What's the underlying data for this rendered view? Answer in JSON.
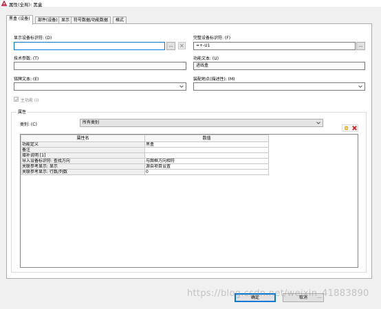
{
  "window": {
    "title": "属性(全局): 黑盒"
  },
  "tabs": [
    {
      "label": "黑盒 (设备)",
      "active": true
    },
    {
      "label": "部件(设备)",
      "active": false
    },
    {
      "label": "显示",
      "active": false
    },
    {
      "label": "符号数据/功能数据",
      "active": false
    },
    {
      "label": "格式",
      "active": false
    }
  ],
  "fields": {
    "display_dt_label": "显示设备标识符: (D)",
    "display_dt_value": "",
    "full_dt_label": "完整设备标识符: (F)",
    "full_dt_value": "=+-U1",
    "tech_params_label": "技术参数: (T)",
    "tech_params_value": "",
    "function_text_label": "功能文本: (U)",
    "function_text_value": "进线盒",
    "engraving_label": "铭牌文本: (E)",
    "engraving_value": "",
    "mounting_label": "装配地点(描述性): (M)",
    "mounting_value": "",
    "main_function_label": "主功能 (I)",
    "main_function_checked": true,
    "ellipsis": "..."
  },
  "properties": {
    "group_title": "属性",
    "category_label": "类别: (C)",
    "category_value": "所有类别",
    "columns": [
      "属性名",
      "数值"
    ],
    "rows": [
      {
        "name": "功能定义",
        "value": "黑盒"
      },
      {
        "name": "备注",
        "value": ""
      },
      {
        "name": "增补说明 [1]",
        "value": ""
      },
      {
        "name": "导入设备标识符: 查找方向",
        "value": "与图框方向相符"
      },
      {
        "name": "关联参考显示: 显示",
        "value": "源自项目设置"
      },
      {
        "name": "关联参考显示: 行数/列数",
        "value": "0"
      }
    ]
  },
  "buttons": {
    "ok": "确定",
    "cancel": "取消"
  },
  "watermark": "https://blog.csdn.net/weixin_41883890",
  "colors": {
    "title_icon": "#c8102e",
    "add_icon": "#e8a000",
    "delete_icon": "#d21f1f",
    "focus_border": "#0078d7"
  }
}
